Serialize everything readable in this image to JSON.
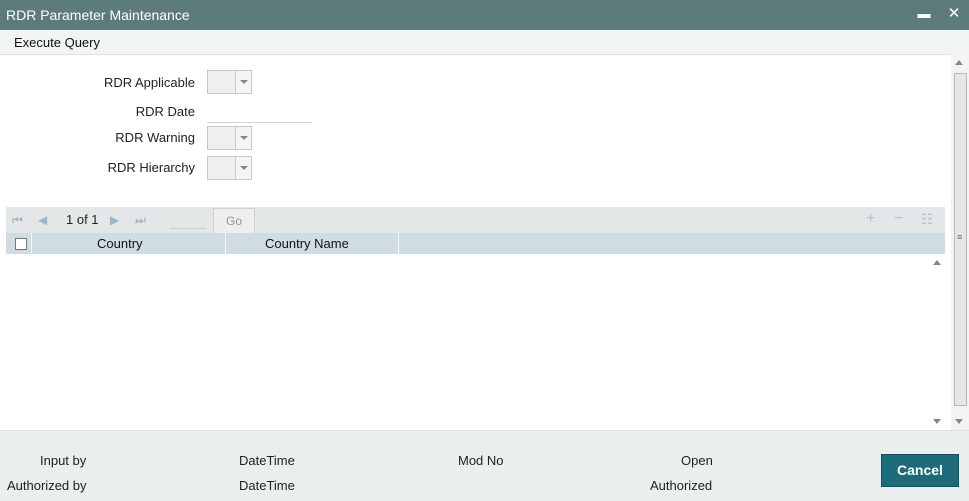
{
  "window": {
    "title": "RDR Parameter Maintenance",
    "minimize_glyph": "▬",
    "close_glyph": "✕"
  },
  "menu": {
    "execute_query": "Execute Query"
  },
  "form": {
    "rdr_applicable_label": "RDR Applicable",
    "rdr_date_label": "RDR Date",
    "rdr_warning_label": "RDR Warning",
    "rdr_hierarchy_label": "RDR Hierarchy"
  },
  "grid": {
    "first_icon": "⏮",
    "prev_icon": "◀",
    "page_text": "1 of 1",
    "next_icon": "▶",
    "last_icon": "⏭",
    "go_label": "Go",
    "add_icon": "+",
    "remove_icon": "−",
    "list_icon": "☷",
    "columns": [
      "Country",
      "Country Name"
    ]
  },
  "footer": {
    "input_by": "Input by",
    "authorized_by": "Authorized by",
    "datetime_1": "DateTime",
    "datetime_2": "DateTime",
    "mod_no": "Mod No",
    "open": "Open",
    "authorized": "Authorized",
    "cancel": "Cancel"
  },
  "colors": {
    "titlebar": "#5d7b7b",
    "grid_header": "#cfdde3",
    "cancel_button": "#1d6a7a"
  }
}
